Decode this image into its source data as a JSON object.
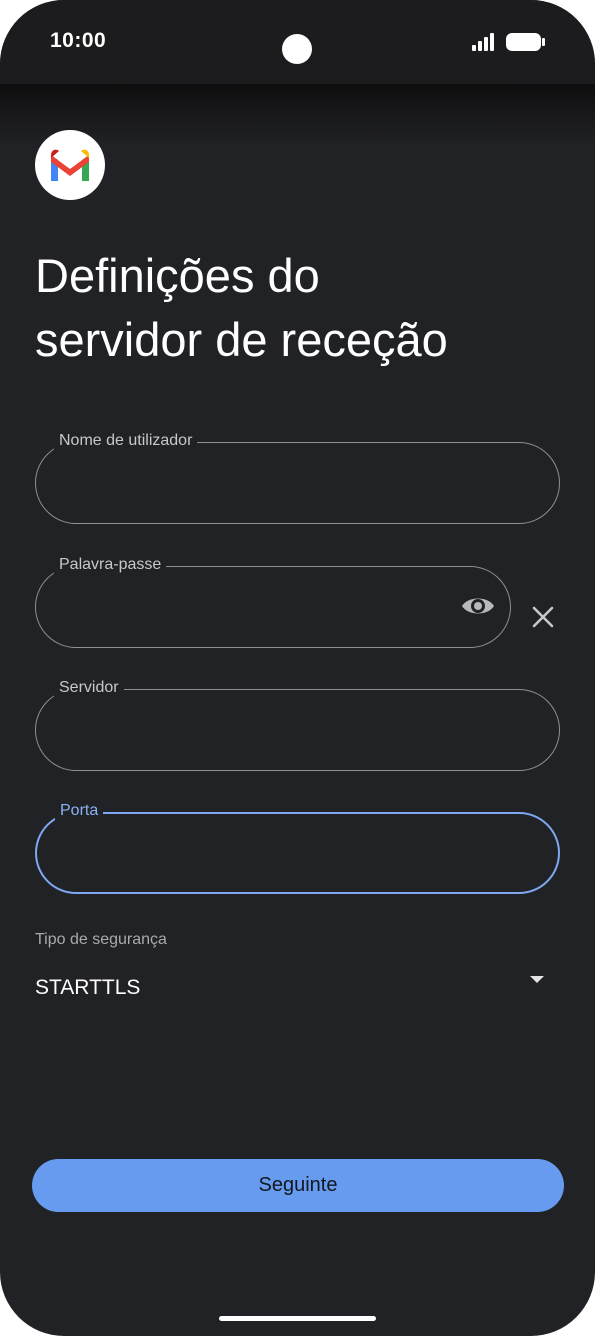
{
  "status_bar": {
    "time": "10:00"
  },
  "header": {
    "logo_icon": "gmail-logo-icon",
    "title": "Definições do\nservidor de receção"
  },
  "form": {
    "username": {
      "label": "Nome de utilizador",
      "value": ""
    },
    "password": {
      "label": "Palavra-passe",
      "value": "",
      "reveal_icon": "eye-icon",
      "clear_icon": "close-icon"
    },
    "server": {
      "label": "Servidor",
      "value": ""
    },
    "port": {
      "label": "Porta",
      "value": ""
    },
    "security": {
      "label": "Tipo de segurança",
      "value": "STARTTLS",
      "dropdown_icon": "arrow-drop-down-icon"
    }
  },
  "next_button": {
    "label": "Seguinte"
  },
  "colors": {
    "background": "#212225",
    "accent": "#679bf0",
    "focus_border": "#7fa8f2"
  }
}
